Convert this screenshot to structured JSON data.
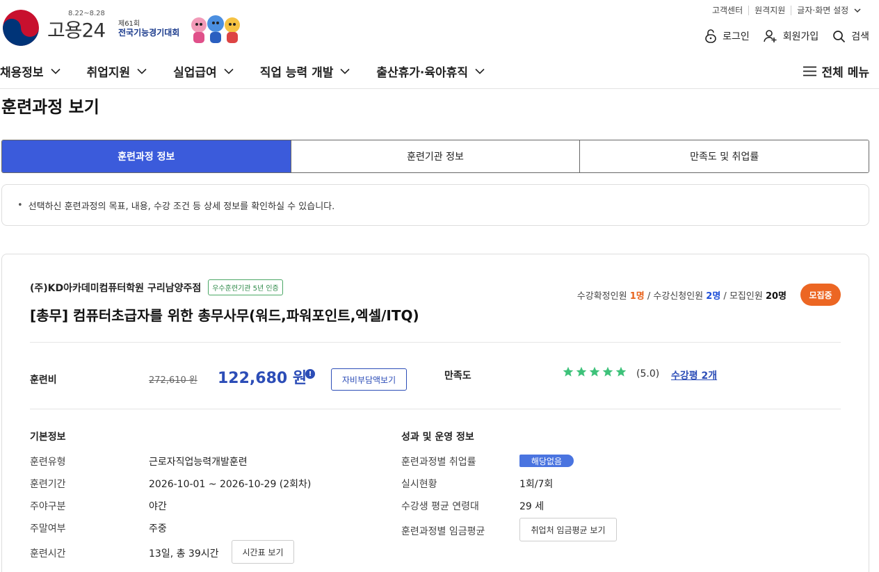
{
  "header": {
    "brand": "고용24",
    "event_date": "8.22~8.28",
    "event_edition": "제61회",
    "event_name": "전국기능경기대회",
    "util_links": [
      "고객센터",
      "원격지원",
      "글자·화면 설정"
    ],
    "login": "로그인",
    "signup": "회원가입",
    "search": "검색",
    "nav": [
      "채용정보",
      "취업지원",
      "실업급여",
      "직업 능력 개발",
      "출산휴가·육아휴직"
    ],
    "all_menu": "전체 메뉴"
  },
  "page_title": "훈련과정 보기",
  "tabs": [
    "훈련과정 정보",
    "훈련기관 정보",
    "만족도 및 취업률"
  ],
  "notice": "선택하신 훈련과정의 목표, 내용, 수강 조건 등 상세 정보를 확인하실 수 있습니다.",
  "course": {
    "institution": "(주)KD아카데미컴퓨터학원 구리남양주점",
    "cert": "우수훈련기관 5년 인증",
    "title": "[총무] 컴퓨터초급자를 위한 총무사무(워드,파워포인트,엑셀/ITQ)",
    "confirmed_label": "수강확정인원",
    "confirmed": "1명",
    "applied_label": "수강신청인원",
    "applied": "2명",
    "recruit_label": "모집인원",
    "recruit": "20명",
    "status": "모집중",
    "fee_label": "훈련비",
    "original_price": "272,610 원",
    "price": "122,680 원",
    "info_mark": "!",
    "selfpay_button": "자비부담액보기",
    "satisfaction_label": "만족도",
    "rating": 5.0,
    "score": "(5.0)",
    "review": "수강평 2개"
  },
  "basic": {
    "title": "기본정보",
    "rows": [
      {
        "k": "훈련유형",
        "v": "근로자직업능력개발훈련"
      },
      {
        "k": "훈련기간",
        "v": "2026-10-01 ~ 2026-10-29 (2회차)"
      },
      {
        "k": "주야구분",
        "v": "야간"
      },
      {
        "k": "주말여부",
        "v": "주중"
      },
      {
        "k": "훈련시간",
        "v": "13일, 총 39시간"
      }
    ],
    "timetable_button": "시간표 보기"
  },
  "perf": {
    "title": "성과 및 운영 정보",
    "rows": [
      {
        "k": "훈련과정별 취업률",
        "v": "해당없음"
      },
      {
        "k": "실시현황",
        "v": "1회/7회"
      },
      {
        "k": "수강생 평균 연령대",
        "v": "29 세"
      },
      {
        "k": "훈련과정별 임금평균",
        "v": ""
      }
    ],
    "wage_button": "취업처 임금평균 보기"
  },
  "colors": {
    "primary": "#3b5bdb",
    "accent_orange": "#ec6623",
    "star_green": "#3ec27a",
    "price_blue": "#2c4db7"
  }
}
